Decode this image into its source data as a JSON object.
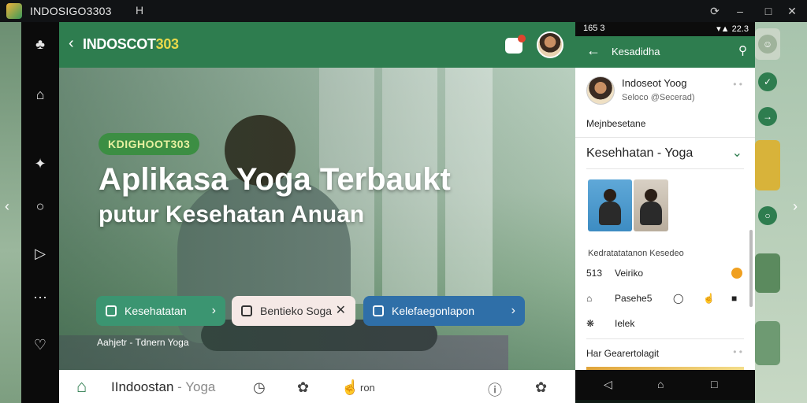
{
  "window": {
    "title": "INDOSIGO3303",
    "tab_label": "H",
    "controls": [
      "⟳",
      "‒",
      "□",
      "✕"
    ]
  },
  "header": {
    "back_glyph": "‹",
    "brand_text": "INDOSCOT",
    "brand_num": "303"
  },
  "hero": {
    "badge": "KDIGHOOT303",
    "title": "Aplikasa Yoga  Terbaukt",
    "subtitle": "putur Kesehatan Anuan",
    "chips": [
      {
        "label": "Kesehatatan",
        "end": "›"
      },
      {
        "label": "Bentieko Soga",
        "end": "✕"
      },
      {
        "label": "Kelefaegonlapon",
        "end": "›"
      }
    ],
    "caption": "Aahjetr - Tdnern Yoga"
  },
  "bottom_nav": {
    "brand": "IIndoostan",
    "brand_sub": " - Yoga",
    "label": "ron"
  },
  "phone": {
    "status_time": "165 3",
    "status_right": "▾▲ 22.3",
    "header_title": "Kesadidha",
    "profile_name": "Indoseot Yoog",
    "profile_handle": "Seloco @Secerad)",
    "description": "Mejnbesetane",
    "section_title": "Kesehhatan - Yoga",
    "category": "Kedratatatanon Kesedeo",
    "rows": [
      {
        "icon": "513",
        "label": "Veiriko"
      },
      {
        "icon": "⌂",
        "label": "Pasehe5"
      },
      {
        "icon": "❋",
        "label": "Ielek"
      }
    ],
    "more_label": "Har Gearertolagit"
  },
  "colors": {
    "brand_green": "#2e7d4f",
    "accent_yellow": "#e8d94a",
    "chip_green": "#3b9571",
    "chip_blue": "#2f6fa8"
  }
}
